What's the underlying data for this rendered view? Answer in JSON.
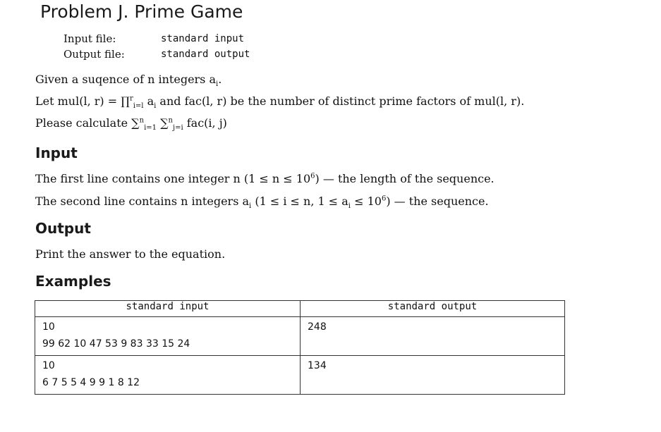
{
  "problem": {
    "title": "Problem J. Prime Game"
  },
  "io": {
    "input_label": "Input file:",
    "input_value": "standard input",
    "output_label": "Output file:",
    "output_value": "standard output"
  },
  "statement": {
    "line1": "Given a suqence of n integers a",
    "line1_sub": "i",
    "line1_end": ".",
    "line2_prefix": "Let mul(l, r) = ∏",
    "line2_sup": "r",
    "line2_sub": "i=l",
    "line2_mid": " a",
    "line2_ai_sub": "i",
    "line2_rest": " and fac(l, r) be the number of distinct prime factors of mul(l, r).",
    "line3_prefix": "Please calculate ∑",
    "line3_sup1": "n",
    "line3_sub1": "i=1",
    "line3_sum2": " ∑",
    "line3_sup2": "n",
    "line3_sub2": "j=i",
    "line3_rest": " fac(i, j)"
  },
  "input_section": {
    "heading": "Input",
    "line1_a": "The first line contains one integer n (1 ≤ n ≤ 10",
    "line1_sup": "6",
    "line1_b": ") — the length of the sequence.",
    "line2_a": "The second line contains n integers a",
    "line2_sub": "i",
    "line2_b": " (1 ≤ i ≤ n, 1 ≤ a",
    "line2_sub2": "i",
    "line2_c": " ≤ 10",
    "line2_sup": "6",
    "line2_d": ") — the sequence."
  },
  "output_section": {
    "heading": "Output",
    "line1": "Print the answer to the equation."
  },
  "examples": {
    "heading": "Examples",
    "col_input": "standard input",
    "col_output": "standard output",
    "rows": [
      {
        "input_line1": "10",
        "input_line2": "99 62 10 47 53 9 83 33 15 24",
        "output": "248"
      },
      {
        "input_line1": "10",
        "input_line2": "6 7 5 5 4 9 9 1 8 12",
        "output": "134"
      }
    ]
  }
}
